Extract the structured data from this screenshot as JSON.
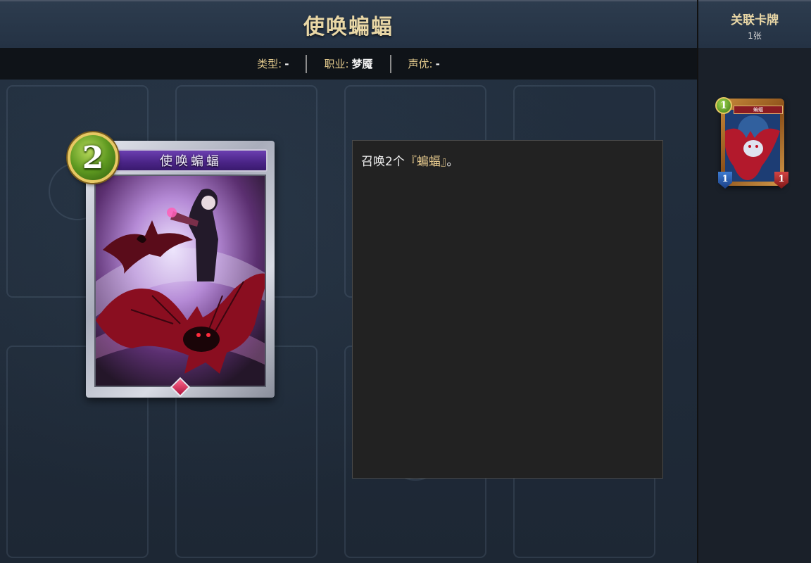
{
  "header": {
    "title": "使唤蝙蝠"
  },
  "info_bar": {
    "type_label": "类型:",
    "type_value": "-",
    "class_label": "职业:",
    "class_value": "梦魇",
    "voice_label": "声优:",
    "voice_value": "-"
  },
  "card": {
    "name": "使唤蝙蝠",
    "cost": "2",
    "cost_color": "#5f9a21",
    "banner_color": "#4a2486"
  },
  "description": {
    "prefix": "召唤2个",
    "keyword": "『蝙蝠』",
    "suffix": "。"
  },
  "sidebar": {
    "heading": "关联卡牌",
    "count": "1张",
    "related_cards": [
      {
        "name": "蝙蝠",
        "cost": "1",
        "attack": "1",
        "life": "1"
      }
    ]
  }
}
